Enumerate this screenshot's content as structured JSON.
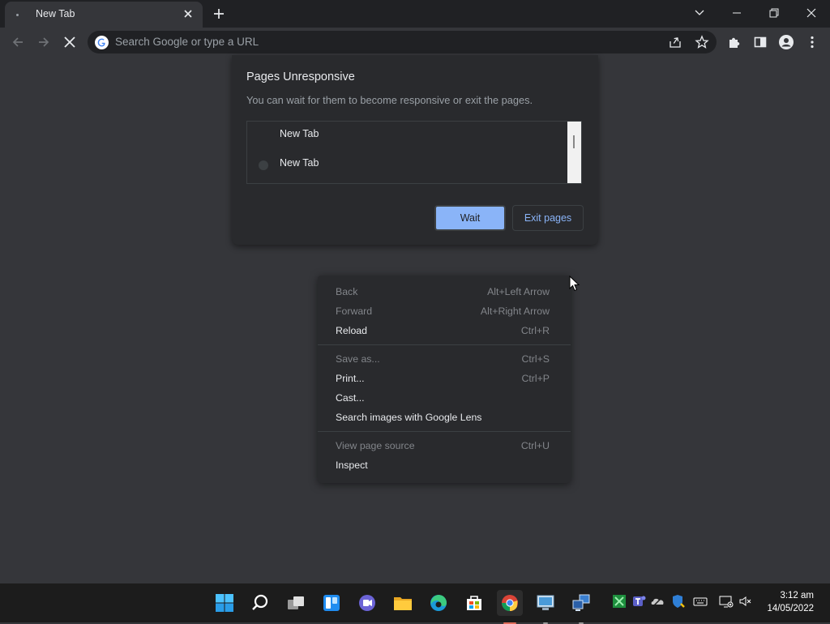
{
  "tab": {
    "title": "New Tab"
  },
  "omnibox": {
    "placeholder": "Search Google or type a URL"
  },
  "dialog": {
    "title": "Pages Unresponsive",
    "message": "You can wait for them to become responsive or exit the pages.",
    "pages": [
      {
        "label": "New Tab"
      },
      {
        "label": "New Tab"
      }
    ],
    "wait_label": "Wait",
    "exit_label": "Exit pages"
  },
  "context_menu": {
    "items": [
      {
        "label": "Back",
        "shortcut": "Alt+Left Arrow",
        "enabled": false
      },
      {
        "label": "Forward",
        "shortcut": "Alt+Right Arrow",
        "enabled": false
      },
      {
        "label": "Reload",
        "shortcut": "Ctrl+R",
        "enabled": true
      },
      {
        "label": "Save as...",
        "shortcut": "Ctrl+S",
        "enabled": false
      },
      {
        "label": "Print...",
        "shortcut": "Ctrl+P",
        "enabled": true
      },
      {
        "label": "Cast...",
        "shortcut": "",
        "enabled": true
      },
      {
        "label": "Search images with Google Lens",
        "shortcut": "",
        "enabled": true
      },
      {
        "label": "View page source",
        "shortcut": "Ctrl+U",
        "enabled": false
      },
      {
        "label": "Inspect",
        "shortcut": "",
        "enabled": true
      }
    ]
  },
  "taskbar": {
    "apps": [
      {
        "name": "start-button",
        "icon": "windows-logo-icon",
        "running": false
      },
      {
        "name": "search-button",
        "icon": "search-icon",
        "running": false
      },
      {
        "name": "task-view-button",
        "icon": "task-view-icon",
        "running": false
      },
      {
        "name": "widgets-button",
        "icon": "widgets-icon",
        "running": false
      },
      {
        "name": "teams-chat-button",
        "icon": "teams-chat-icon",
        "running": false
      },
      {
        "name": "file-explorer-button",
        "icon": "folder-icon",
        "running": false
      },
      {
        "name": "edge-button",
        "icon": "edge-icon",
        "running": false
      },
      {
        "name": "store-button",
        "icon": "store-icon",
        "running": false
      },
      {
        "name": "chrome-button",
        "icon": "chrome-icon",
        "running": true
      },
      {
        "name": "remote-desktop-button",
        "icon": "remote-desktop-icon",
        "running": true
      },
      {
        "name": "network-app-button",
        "icon": "network-computers-icon",
        "running": true
      }
    ],
    "clock": {
      "time": "3:12 am",
      "date": "14/05/2022"
    }
  },
  "colors": {
    "accent": "#8ab4f8",
    "frame": "#202124",
    "content": "#35363a",
    "dialog": "#292a2d",
    "chrome_indicator": "#e06c5a"
  }
}
